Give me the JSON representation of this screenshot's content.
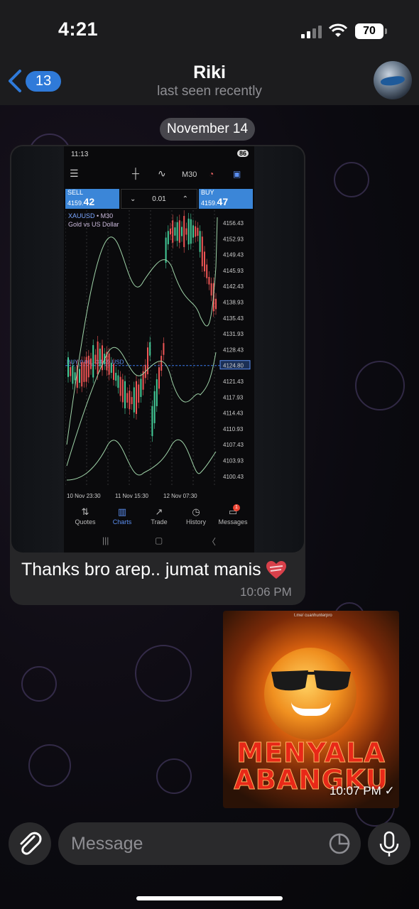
{
  "status_bar": {
    "time": "4:21",
    "battery": "70"
  },
  "header": {
    "back_count": "13",
    "name": "Riki",
    "status": "last seen recently"
  },
  "date_separator": "November 14",
  "screenshot": {
    "status_time": "11:13",
    "status_badge": "86",
    "timeframe": "M30",
    "sell_label": "SELL",
    "sell_price_small": "4159.",
    "sell_price_big": "42",
    "lot": "0.01",
    "buy_label": "BUY",
    "buy_price_small": "4159.",
    "buy_price_big": "47",
    "symbol": "XAUUSD",
    "symbol_tf": "• M30",
    "symbol_desc": "Gold vs US Dollar",
    "position_label": "BUY 0.01, -34.99 USD",
    "position_price": "4124.80",
    "price_ticks": [
      "4156.43",
      "4152.93",
      "4149.43",
      "4145.93",
      "4142.43",
      "4138.93",
      "4135.43",
      "4131.93",
      "4128.43",
      "4124.80",
      "4121.43",
      "4117.93",
      "4114.43",
      "4110.93",
      "4107.43",
      "4103.93",
      "4100.43"
    ],
    "date_ticks": [
      "10 Nov 23:30",
      "11 Nov 15:30",
      "12 Nov 07:30"
    ],
    "tabs": [
      "Quotes",
      "Charts",
      "Trade",
      "History",
      "Messages"
    ],
    "messages_badge": "1"
  },
  "incoming": {
    "text": "Thanks bro arep.. jumat manis",
    "time": "10:06 PM"
  },
  "outgoing": {
    "caption_top": "t.me/ cuanhunterpro",
    "meme_line1": "MENYALA",
    "meme_line2": "ABANGKU",
    "time": "10:07 PM"
  },
  "composer": {
    "placeholder": "Message"
  },
  "colors": {
    "accent": "#2f7ad9",
    "bubble": "#262628",
    "bar": "#1c1c1e"
  }
}
